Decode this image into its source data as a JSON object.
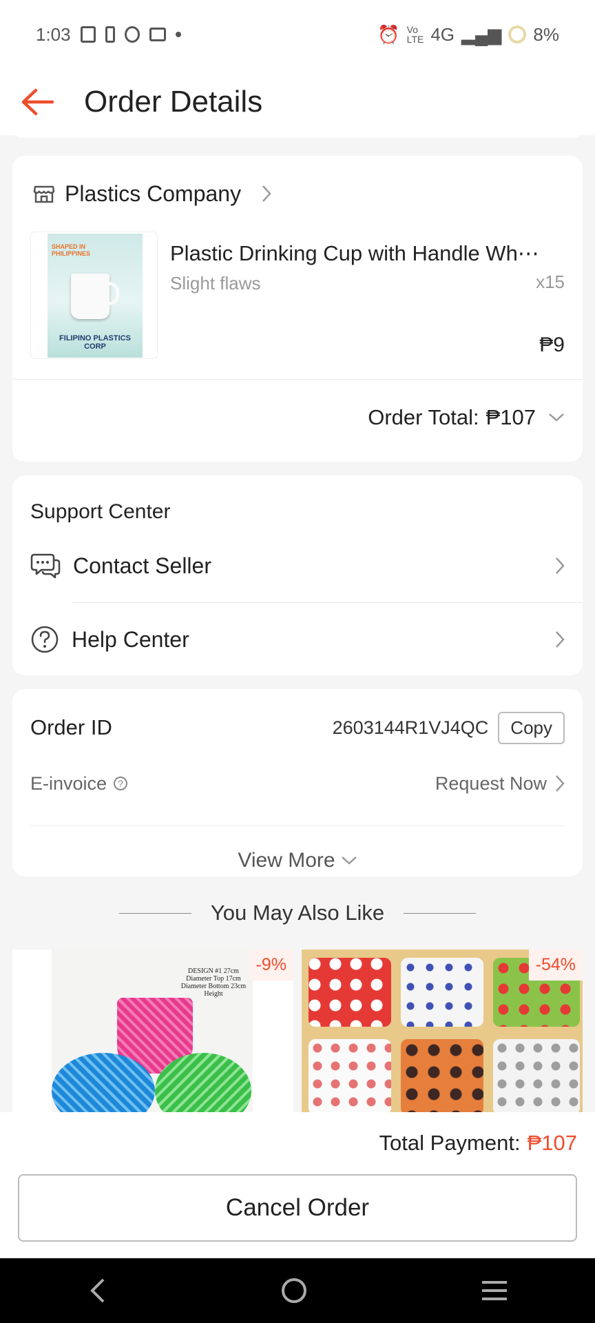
{
  "status_bar": {
    "time": "1:03",
    "network": "4G",
    "battery": "8%"
  },
  "header": {
    "title": "Order Details"
  },
  "shop": {
    "name": "Plastics Company"
  },
  "product": {
    "name": "Plastic Drinking Cup with Handle Wh⋯",
    "variation": "Slight flaws",
    "quantity": "x15",
    "price": "₱9",
    "image_text_top": "SHAPED IN PHILIPPINES",
    "image_text_bottom": "FILIPINO PLASTICS CORP"
  },
  "order_total": {
    "label": "Order Total:",
    "value": "₱107"
  },
  "support": {
    "title": "Support Center",
    "contact_label": "Contact Seller",
    "help_label": "Help Center"
  },
  "order_info": {
    "id_label": "Order ID",
    "id_value": "2603144R1VJ4QC",
    "copy_label": "Copy",
    "einvoice_label": "E-invoice",
    "request_label": "Request Now",
    "view_more_label": "View More"
  },
  "recommendations": {
    "title": "You May Also Like",
    "items": [
      {
        "discount": "-9%",
        "image_caption": "DESIGN #1 27cm Diameter Top 17cm Diameter Bottom 23cm Height"
      },
      {
        "discount": "-54%"
      }
    ]
  },
  "footer": {
    "payment_label": "Total Payment:",
    "payment_value": "₱107",
    "cancel_label": "Cancel Order"
  },
  "colors": {
    "accent": "#ee4d2d",
    "background": "#f5f5f5"
  },
  "icons": [
    "back-arrow-icon",
    "shop-icon",
    "chat-icon",
    "help-icon",
    "chevron-right-icon",
    "chevron-down-icon"
  ]
}
